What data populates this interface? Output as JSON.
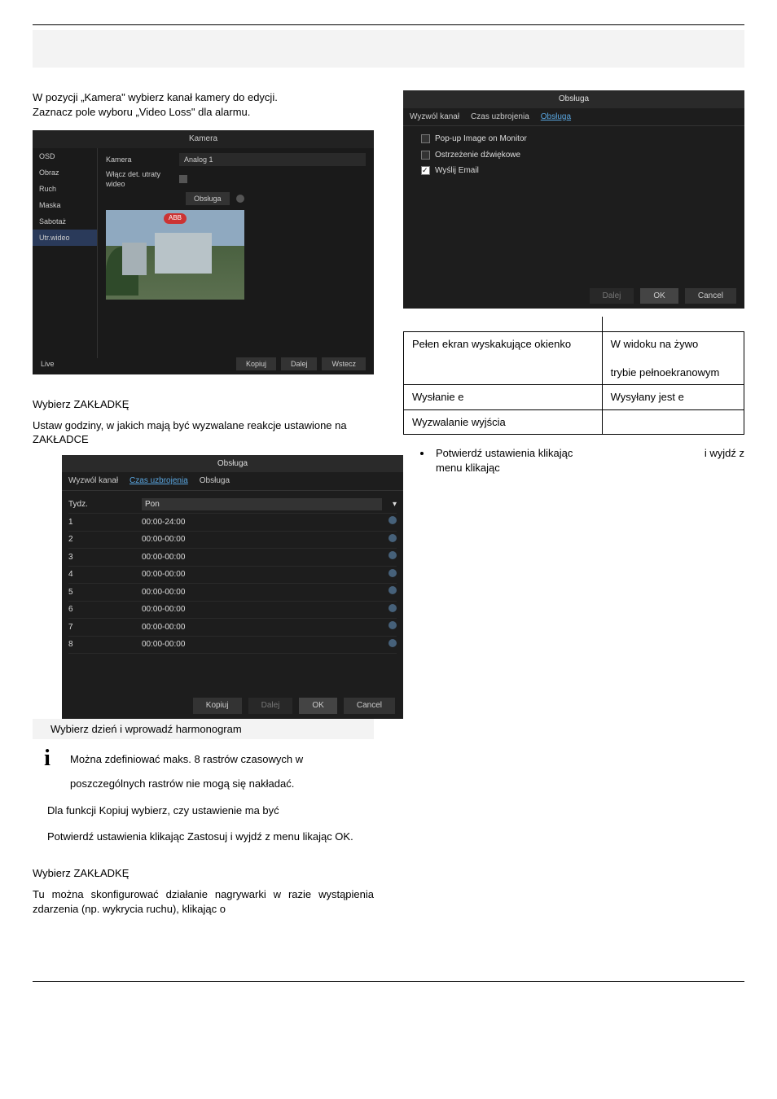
{
  "intro_1": "W pozycji „Kamera\" wybierz kanał kamery do edycji.",
  "intro_2": "Zaznacz pole wyboru „Video Loss\" dla alarmu.",
  "kamera": {
    "title": "Kamera",
    "side": [
      "OSD",
      "Obraz",
      "Ruch",
      "Maska",
      "Sabotaż",
      "Utr.wideo"
    ],
    "row_cam_lbl": "Kamera",
    "row_cam_val": "Analog 1",
    "row_loss_lbl": "Włącz det. utraty wideo",
    "row_handle_lbl": "Obsługa",
    "preview_badge": "ABB",
    "footer_live": "Live",
    "footer_buttons": [
      "Kopiuj",
      "Dalej",
      "Wstecz"
    ]
  },
  "tab_heading_1": "Wybierz ZAKŁADKĘ",
  "tab_para_1": "Ustaw godziny, w jakich mają być wyzwalane reakcje ustawione na ZAKŁADCE",
  "sched": {
    "title": "Obsługa",
    "tabs": [
      "Wyzwól kanał",
      "Czas uzbrojenia",
      "Obsługa"
    ],
    "active_tab": 1,
    "week_lbl": "Tydz.",
    "week_val": "Pon",
    "rows": [
      {
        "n": "1",
        "t": "00:00-24:00"
      },
      {
        "n": "2",
        "t": "00:00-00:00"
      },
      {
        "n": "3",
        "t": "00:00-00:00"
      },
      {
        "n": "4",
        "t": "00:00-00:00"
      },
      {
        "n": "5",
        "t": "00:00-00:00"
      },
      {
        "n": "6",
        "t": "00:00-00:00"
      },
      {
        "n": "7",
        "t": "00:00-00:00"
      },
      {
        "n": "8",
        "t": "00:00-00:00"
      }
    ],
    "buttons": [
      "Kopiuj",
      "Dalej",
      "OK",
      "Cancel"
    ]
  },
  "caption_sched": "Wybierz dzień i wprowadź harmonogram",
  "note_1": "Można zdefiniować maks. 8 rastrów czasowych w",
  "note_2": "poszczególnych rastrów nie mogą się nakładać.",
  "note_3": "Dla funkcji Kopiuj wybierz, czy ustawienie ma być",
  "note_4": "Potwierdź ustawienia klikając Zastosuj i wyjdź z menu likając OK.",
  "tab_heading_2": "Wybierz ZAKŁADKĘ",
  "tab_para_2": "Tu można skonfigurować działanie nagrywarki w razie wystąpienia zdarzenia (np. wykrycia ruchu), klikając o",
  "handle": {
    "title": "Obsługa",
    "tabs": [
      "Wyzwól kanał",
      "Czas uzbrojenia",
      "Obsługa"
    ],
    "active_tab": 2,
    "options": [
      {
        "label": "Pop-up Image on Monitor",
        "checked": false
      },
      {
        "label": "Ostrzeżenie dźwiękowe",
        "checked": false
      },
      {
        "label": "Wyślij Email",
        "checked": true
      }
    ],
    "buttons": [
      "Dalej",
      "OK",
      "Cancel"
    ]
  },
  "desc_table": [
    [
      "Pełen ekran wyskakujące okienko",
      "W widoku na żywo\n\ntrybie pełnoekranowym"
    ],
    [
      "Wysłanie e",
      "Wysyłany jest e"
    ],
    [
      "Wyzwalanie wyjścia",
      ""
    ]
  ],
  "bullet_1a": "Potwierdź ustawienia klikając",
  "bullet_1b": "i wyjdź z",
  "bullet_2": "menu klikając"
}
